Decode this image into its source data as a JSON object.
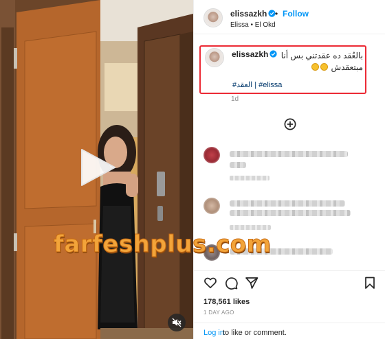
{
  "header": {
    "username": "elissazkh",
    "separator": "•",
    "follow_label": "Follow",
    "location": "Elissa • El Okd"
  },
  "caption": {
    "username": "elissazkh",
    "line1": "بالعُقد ده عقدتني بس أنا",
    "line2": "مبتعقدش",
    "hashtags": "#العقد | #elissa",
    "time": "1d"
  },
  "watermark": {
    "text": "farfeshplus.com"
  },
  "post": {
    "likes": "178,561 likes",
    "time_ago": "1 DAY AGO"
  },
  "footer": {
    "login_label": "Log in",
    "login_suffix": "to like or comment."
  },
  "colors": {
    "accent": "#0095f6",
    "highlight_box": "#ec2a35",
    "watermark": "#f2a43a",
    "hashtag": "#00376b"
  },
  "icons": {
    "verified": "verified-badge-icon",
    "play": "play-icon",
    "mute": "muted-speaker-icon",
    "more_comments": "plus-circle-icon",
    "like": "heart-icon",
    "comment": "comment-bubble-icon",
    "share": "paper-plane-icon",
    "save": "bookmark-icon"
  }
}
